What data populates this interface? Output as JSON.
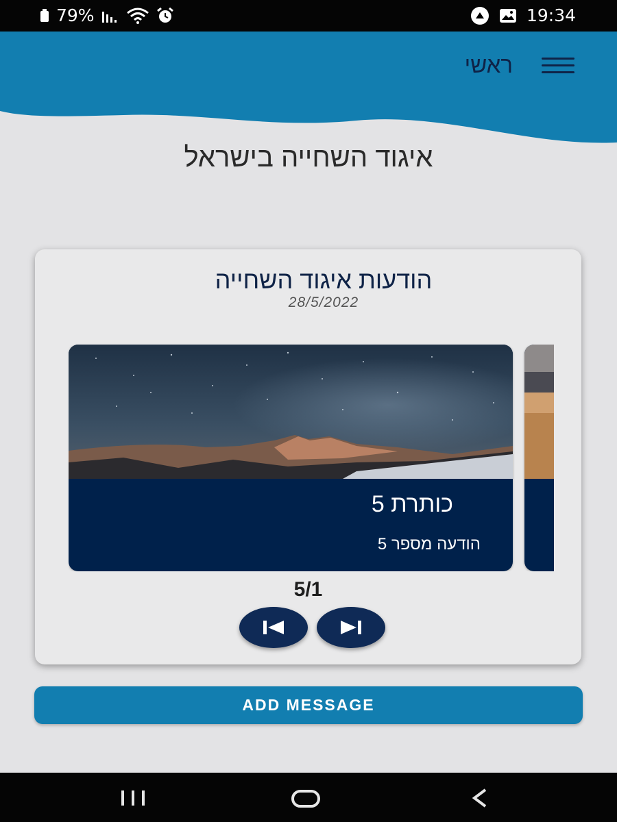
{
  "status_bar": {
    "battery_percent": "79%",
    "time": "19:34",
    "icons": [
      "battery-icon",
      "signal-icon",
      "wifi-icon",
      "alarm-icon",
      "notification-icon",
      "image-icon"
    ]
  },
  "header": {
    "nav_title": "ראשי",
    "menu_icon": "hamburger-icon"
  },
  "page": {
    "title": "איגוד השחייה בישראל"
  },
  "messages_card": {
    "title": "הודעות איגוד השחייה",
    "date": "28/5/2022",
    "current_slide": {
      "heading": "כותרת 5",
      "body": "הודעה מספר 5"
    },
    "counter": "5/1",
    "prev_icon": "skip-previous-icon",
    "next_icon": "skip-next-icon"
  },
  "add_message_label": "ADD MESSAGE",
  "system_nav": {
    "icons": [
      "recent-apps-icon",
      "home-icon",
      "back-icon"
    ]
  },
  "colors": {
    "header_blue": "#127eb0",
    "navy": "#00214b",
    "background": "#e3e3e5"
  }
}
